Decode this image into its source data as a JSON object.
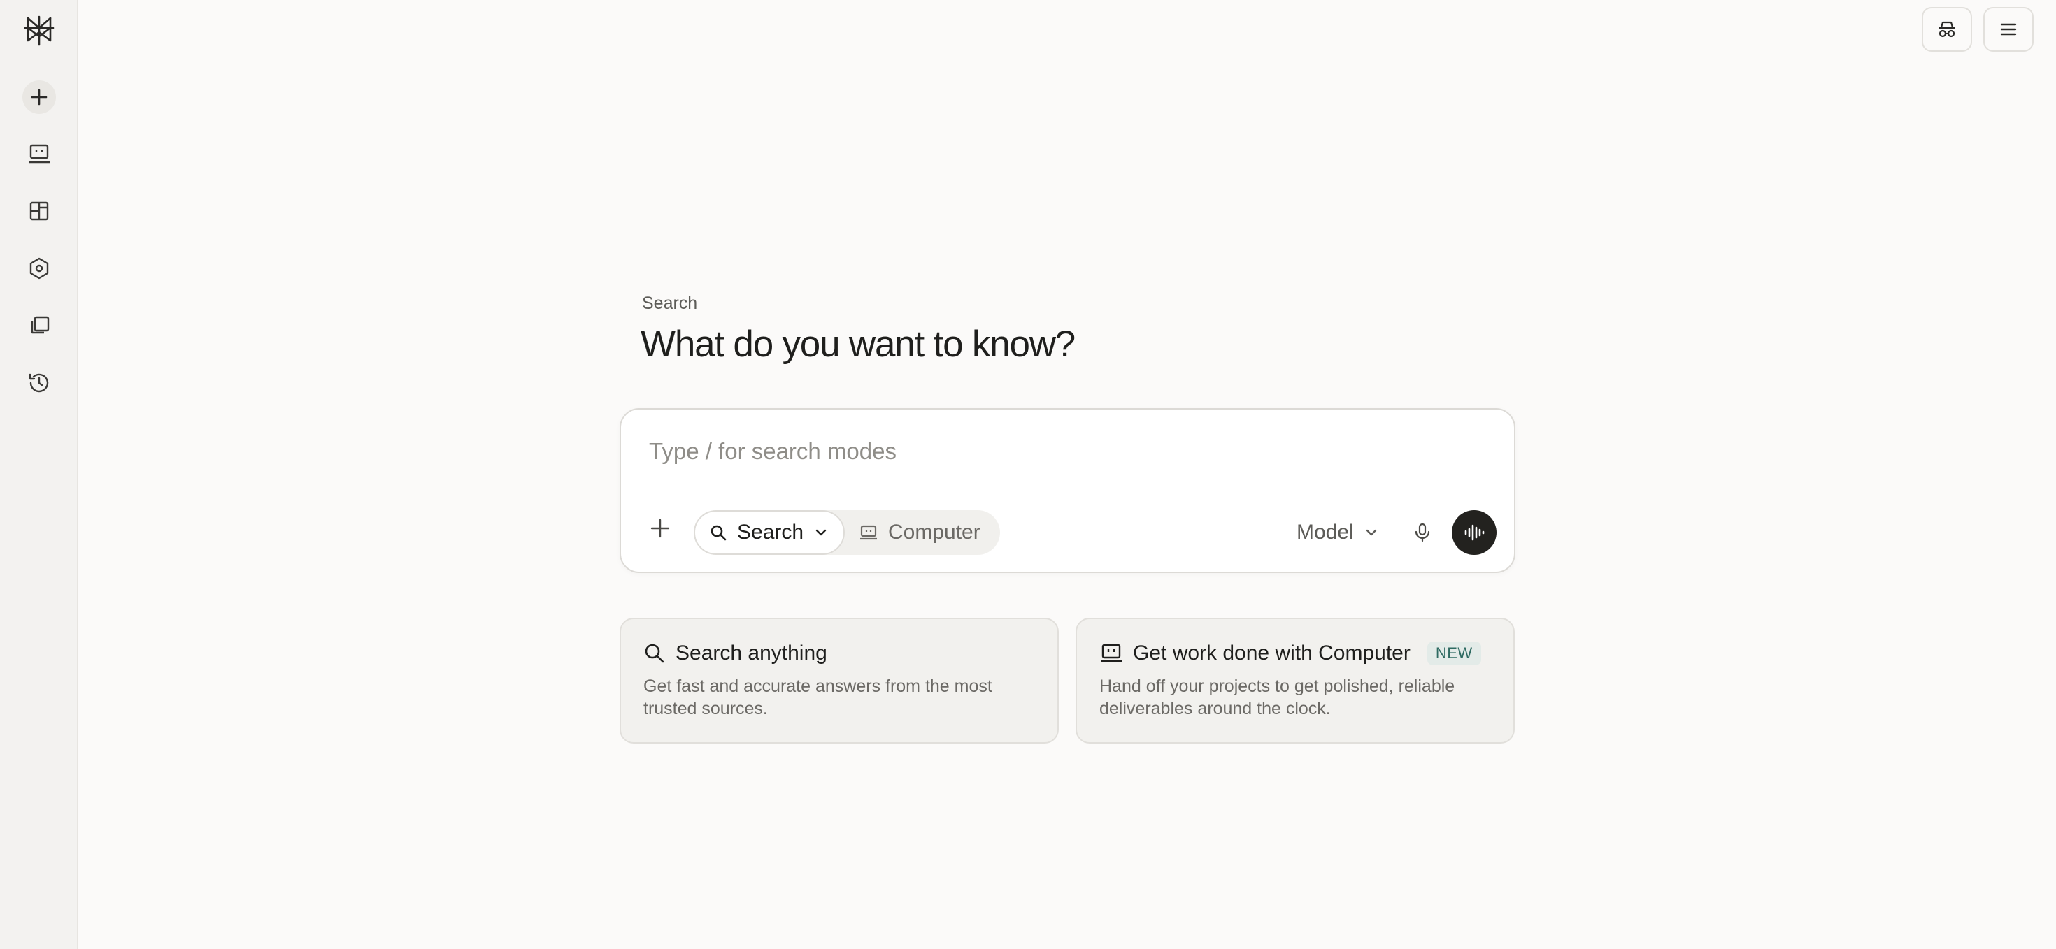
{
  "brand": {
    "logo_icon": "perplexity-logo-icon"
  },
  "sidebar": {
    "new_thread_icon": "plus-icon",
    "items": [
      {
        "name": "computer",
        "icon": "laptop-icon"
      },
      {
        "name": "spaces",
        "icon": "panels-icon"
      },
      {
        "name": "discover",
        "icon": "hexagon-icon"
      },
      {
        "name": "library",
        "icon": "stacked-pages-icon"
      },
      {
        "name": "history",
        "icon": "history-icon"
      }
    ]
  },
  "top_bar": {
    "buttons": [
      {
        "name": "incognito",
        "icon": "incognito-icon"
      },
      {
        "name": "menu",
        "icon": "hamburger-menu-icon"
      }
    ]
  },
  "main": {
    "eyebrow": "Search",
    "headline": "What do you want to know?"
  },
  "composer": {
    "placeholder": "Type / for search modes",
    "value": "",
    "modes": [
      {
        "label": "Search",
        "icon": "search-icon",
        "selected": true
      },
      {
        "label": "Computer",
        "icon": "laptop-icon",
        "selected": false
      }
    ],
    "model_label": "Model"
  },
  "cards": [
    {
      "title": "Search anything",
      "description": "Get fast and accurate answers from the most trusted sources.",
      "icon": "search-icon"
    },
    {
      "title": "Get work done with Computer",
      "badge": "NEW",
      "description": "Hand off your projects to get polished, reliable deliverables around the clock.",
      "icon": "laptop-icon"
    }
  ],
  "colors": {
    "page_bg": "#fbfaf9",
    "sidebar_bg": "#f3f2f0",
    "voice_button": "#23221f",
    "badge_bg": "#e3ebe8",
    "badge_text": "#2f6b62"
  }
}
